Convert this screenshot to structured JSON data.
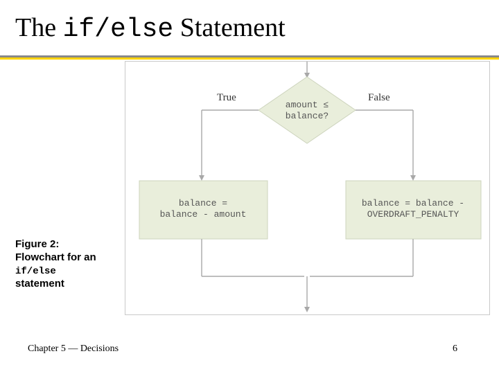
{
  "title": {
    "pre": "The ",
    "code": "if/else",
    "post": " Statement"
  },
  "caption": {
    "l1": "Figure 2:",
    "l2": "Flowchart for an ",
    "code": "if/else",
    "l3": "statement"
  },
  "footer": {
    "left": "Chapter 5 — Decisions",
    "page": "6"
  },
  "chart_data": {
    "type": "diagram",
    "title": "if/else flowchart",
    "nodes": [
      {
        "id": "cond",
        "kind": "decision",
        "text": "amount ≤\nbalance?"
      },
      {
        "id": "tblk",
        "kind": "process",
        "text": "balance =\nbalance - amount"
      },
      {
        "id": "fblk",
        "kind": "process",
        "text": "balance = balance -\nOVERDRAFT_PENALTY"
      }
    ],
    "edges": [
      {
        "from": "cond",
        "to": "tblk",
        "label": "True"
      },
      {
        "from": "cond",
        "to": "fblk",
        "label": "False"
      },
      {
        "from": "tblk",
        "to": "merge"
      },
      {
        "from": "fblk",
        "to": "merge"
      }
    ],
    "labels": {
      "true": "True",
      "false": "False"
    }
  }
}
